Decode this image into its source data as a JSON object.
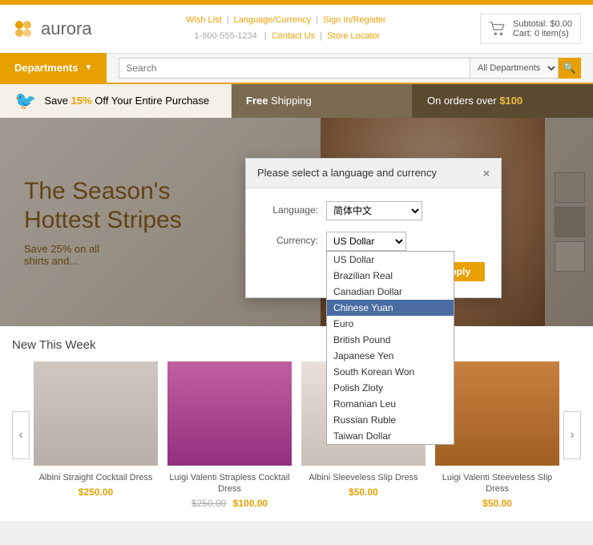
{
  "top_bar": {},
  "header": {
    "logo_text": "aurora",
    "links": {
      "wish_list": "Wish List",
      "language_currency": "Language/Currency",
      "sign_in": "Sign In/Register",
      "phone": "1-800-555-1234",
      "contact_us": "Contact Us",
      "store_locator": "Store Locator"
    },
    "cart": {
      "subtotal_label": "Subtotal: $0.00",
      "cart_label": "Cart: 0 item(s)"
    }
  },
  "nav": {
    "departments_label": "Departments",
    "search_placeholder": "Search",
    "search_departments_label": "All Departments",
    "search_icon": "🔍"
  },
  "promo": [
    {
      "icon": "🐦",
      "text1": "Save ",
      "bold": "15%",
      "text2": " Off Your Entire Purchase"
    },
    {
      "text1": "",
      "bold": "Free",
      "text2": " Shipping"
    },
    {
      "text1": "On orders over ",
      "bold": "$100"
    }
  ],
  "hero": {
    "title1": "The Season's",
    "title2": "Hottest Stripes",
    "subtitle": "Save 25% on all",
    "subtitle2": "shirts and..."
  },
  "modal": {
    "title": "Please select a language and currency",
    "close_label": "×",
    "language_label": "Language:",
    "language_value": "简体中文",
    "currency_label": "Currency:",
    "currency_value": "US Dollar",
    "currency_options": [
      {
        "value": "US Dollar",
        "selected": true
      },
      {
        "value": "Brazilian Real",
        "selected": false
      },
      {
        "value": "Canadian Dollar",
        "selected": false
      },
      {
        "value": "Chinese Yuan",
        "selected": true,
        "highlighted": true
      },
      {
        "value": "Euro",
        "selected": false
      },
      {
        "value": "British Pound",
        "selected": false
      },
      {
        "value": "Japanese Yen",
        "selected": false
      },
      {
        "value": "South Korean Won",
        "selected": false
      },
      {
        "value": "Polish Zloty",
        "selected": false
      },
      {
        "value": "Romanian Leu",
        "selected": false
      },
      {
        "value": "Russian Ruble",
        "selected": false
      },
      {
        "value": "Taiwan Dollar",
        "selected": false
      }
    ],
    "apply_label": "Apply"
  },
  "products": {
    "section_title": "New This Week",
    "items": [
      {
        "name": "Albini Straight Cocktail Dress",
        "price": "$250.00",
        "old_price": null
      },
      {
        "name": "Luigi Valenti Strapless Cocktail Dress",
        "price": "$100.00",
        "old_price": "$250.00"
      },
      {
        "name": "Albini Sleeveless Slip Dress",
        "price": "$50.00",
        "old_price": null
      },
      {
        "name": "Luigi Valenti Steeveless Slip Dress",
        "price": "$50.00",
        "old_price": null
      }
    ]
  }
}
